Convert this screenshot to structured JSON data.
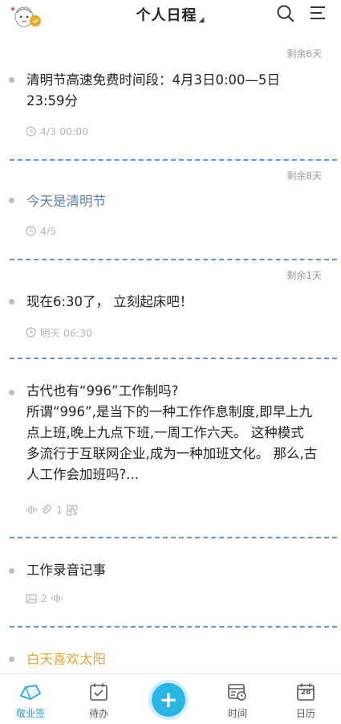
{
  "header": {
    "title": "个人日程",
    "caret": "◢"
  },
  "cards": [
    {
      "remaining": "剩余6天",
      "text_line1": "清明节高速免费时间段：4月3日0:00—5日",
      "text_line2": "23:59分",
      "meta": "4/3 00:00"
    },
    {
      "remaining": "剩余8天",
      "text": "今天是清明节",
      "meta": "4/5"
    },
    {
      "remaining": "剩余1天",
      "text": "现在6:30了， 立刻起床吧！",
      "meta": "明天 06:30"
    },
    {
      "lines": [
        "古代也有“996”工作制吗?",
        "所谓“996”,是当下的一种工作作息制度,即早上九",
        "点上班,晚上九点下班,一周工作六天。 这种模式",
        "多流行于互联网企业,成为一种加班文化。 那么,古",
        "人工作会加班吗?..."
      ],
      "attach_count": "1"
    },
    {
      "text": "工作录音记事",
      "image_count": "2"
    },
    {
      "text": "白天喜欢太阳"
    }
  ],
  "tabs": [
    {
      "label": "敬业签",
      "icon": "note-icon",
      "active": true
    },
    {
      "label": "待办",
      "icon": "todo-icon"
    },
    {
      "label": "+",
      "icon": "add-icon"
    },
    {
      "label": "时间",
      "icon": "time-icon"
    },
    {
      "label": "日历",
      "icon": "calendar-icon",
      "day": "28"
    }
  ],
  "colors": {
    "accent": "#29b5e3",
    "separator": "#5b95d3",
    "blue_text": "#5b7fad",
    "gold_text": "#e0a63b"
  }
}
